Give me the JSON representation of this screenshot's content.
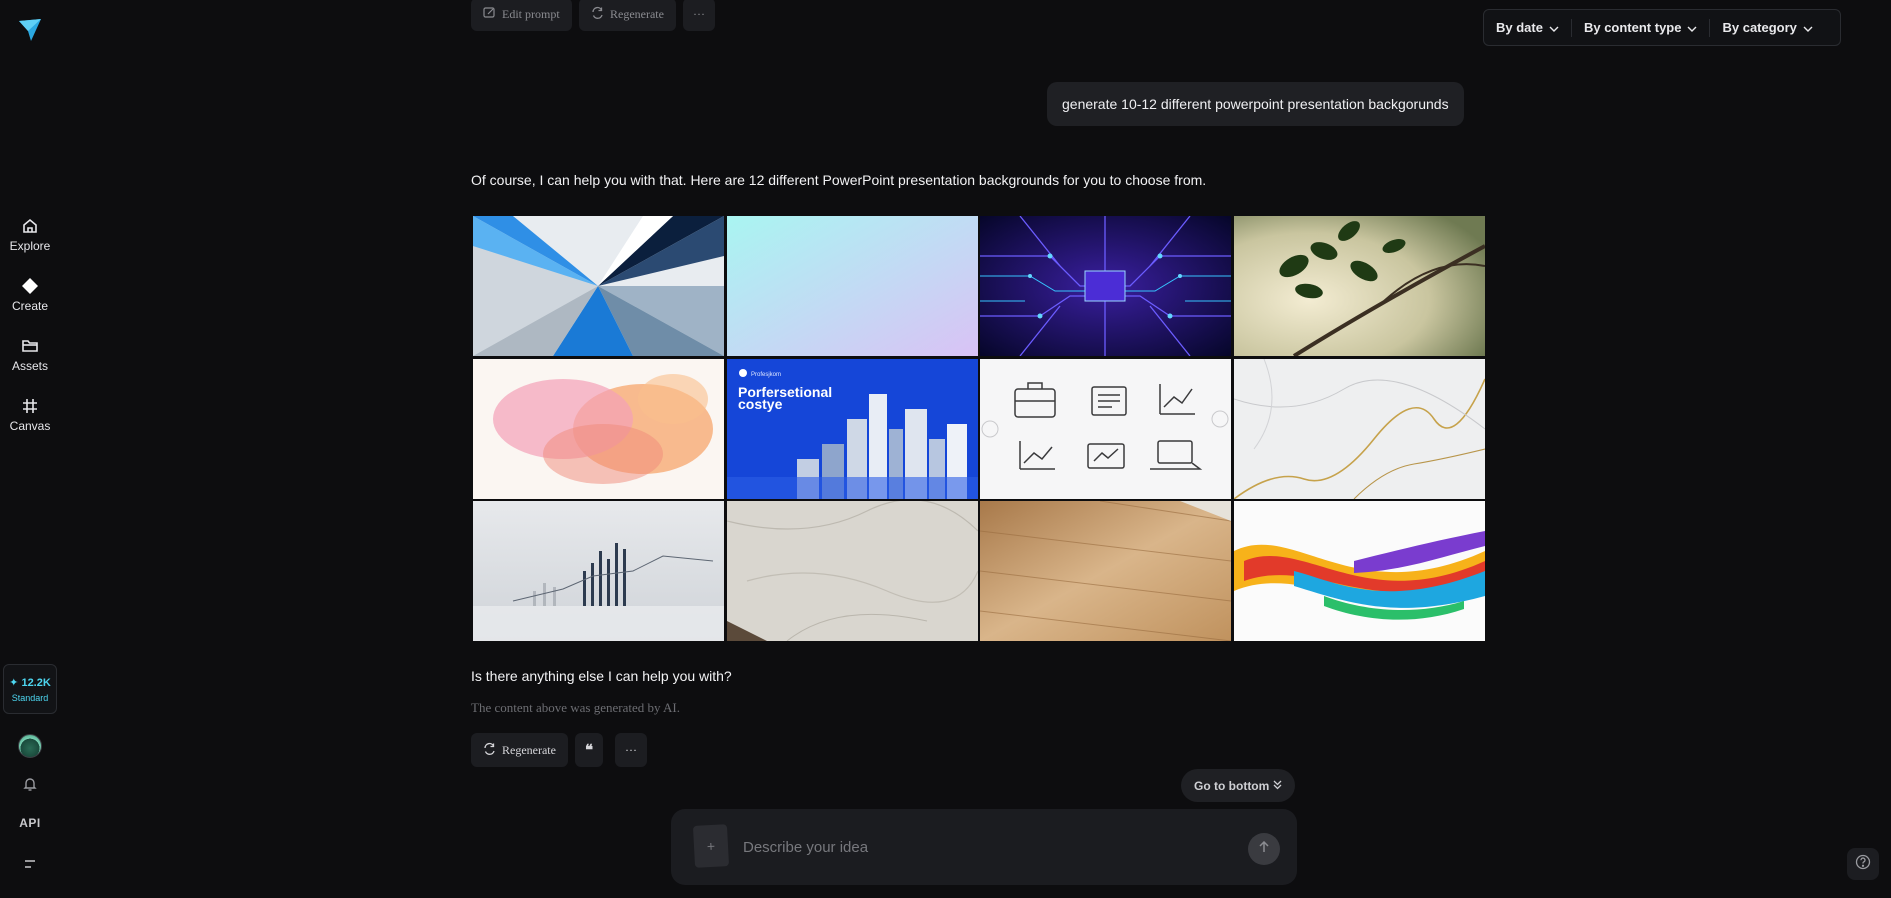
{
  "sidebar": {
    "items": [
      {
        "label": "Explore",
        "icon": "home-icon"
      },
      {
        "label": "Create",
        "icon": "diamond-icon"
      },
      {
        "label": "Assets",
        "icon": "folder-icon"
      },
      {
        "label": "Canvas",
        "icon": "crop-icon"
      }
    ],
    "credits": {
      "amount": "✦ 12.2K",
      "tier": "Standard"
    },
    "api_label": "API"
  },
  "prev_actions": {
    "edit_prompt": "Edit prompt",
    "regenerate": "Regenerate",
    "more": "···"
  },
  "filters": [
    "By date",
    "By content type",
    "By category"
  ],
  "conversation": {
    "user_prompt": "generate 10-12 different powerpoint presentation backgorunds",
    "reply": "Of course, I can help you with that. Here are 12 different PowerPoint presentation backgrounds for you to choose from.",
    "followup": "Is there anything else I can help you with?",
    "disclaimer": "The content above was generated by AI."
  },
  "thumbnail_text": {
    "corporate_brand": "Profesjkom",
    "corporate_title_line1": "Porfersetional",
    "corporate_title_line2": "costye"
  },
  "actions": {
    "regenerate": "Regenerate",
    "quote": "❝",
    "more": "···"
  },
  "go_to_bottom": "Go to bottom",
  "composer": {
    "placeholder": "Describe your idea",
    "attach": "+"
  },
  "colors": {
    "accent": "#4dd6f0",
    "background": "#0d0d0f"
  }
}
